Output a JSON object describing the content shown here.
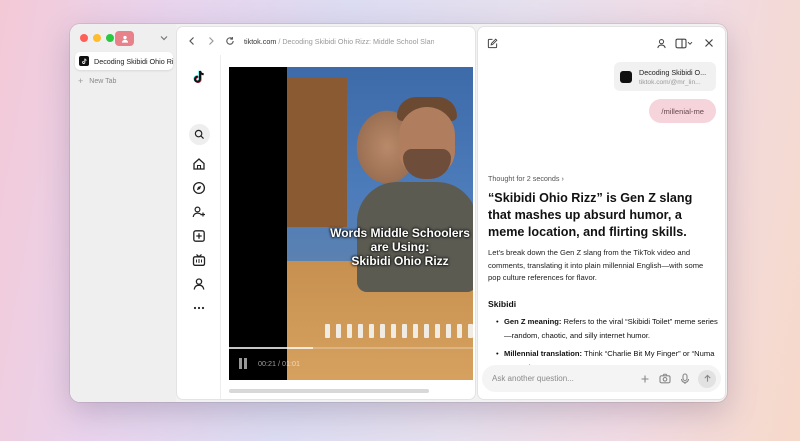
{
  "sidebar": {
    "active_tab": {
      "title": "Decoding Skibidi Ohio Rizz: Middle School Slang Ex..."
    },
    "new_tab_label": "New Tab"
  },
  "browser": {
    "url_domain": "tiktok.com",
    "url_path": " / Decoding Skibidi Ohio Rizz: Middle School Slang Ex..."
  },
  "video": {
    "caption_line1": "Words Middle Schoolers",
    "caption_line2": "are Using:",
    "caption_line3": "Skibidi Ohio Rizz",
    "time": "00:21 / 01:01",
    "progress": 0.344
  },
  "assistant": {
    "context_card": {
      "title": "Decoding Skibidi O...",
      "source": "tiktok.com/@mr_lin..."
    },
    "user_message": "/millenial-me",
    "thought_label": "Thought for 2 seconds",
    "answer_title": "“Skibidi Ohio Rizz” is Gen Z slang that mashes up absurd humor, a meme location, and flirting skills.",
    "answer_intro": "Let’s break down the Gen Z slang from the TikTok video and comments, translating it into plain millennial English—with some pop culture references for flavor.",
    "section_title": "Skibidi",
    "bullets": [
      {
        "label": "Gen Z meaning:",
        "text": " Refers to the viral “Skibidi Toilet” meme series—random, chaotic, and silly internet humor."
      },
      {
        "label": "Millennial translation:",
        "text": " Think “Charlie Bit My Finger” or “Numa Numa” but ..."
      }
    ],
    "composer_placeholder": "Ask another question..."
  }
}
